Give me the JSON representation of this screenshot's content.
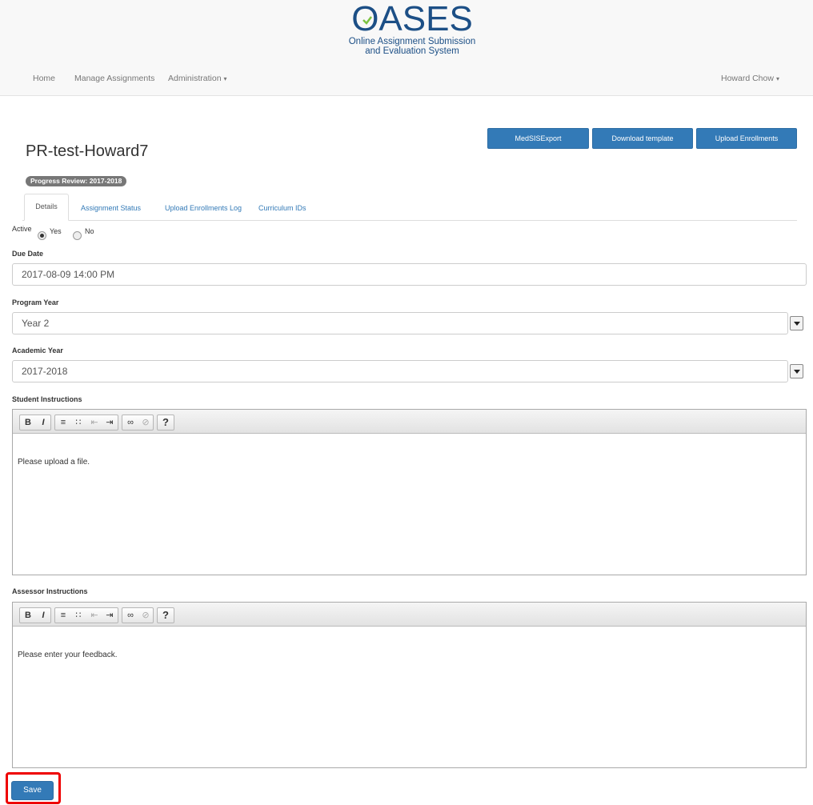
{
  "brand": {
    "logo_word": "OASES",
    "subtitle_line1": "Online Assignment Submission",
    "subtitle_line2": "and Evaluation System"
  },
  "nav": {
    "home": "Home",
    "manage": "Manage Assignments",
    "admin": "Administration",
    "user": "Howard Chow"
  },
  "page": {
    "title": "PR-test-Howard7",
    "badge": "Progress Review: 2017-2018"
  },
  "actions": {
    "medsis": "MedSISExport",
    "download": "Download template",
    "upload": "Upload Enrollments"
  },
  "tabs": {
    "details": "Details",
    "status": "Assignment Status",
    "log": "Upload Enrollments Log",
    "curriculum": "Curriculum IDs"
  },
  "form": {
    "active_label": "Active",
    "yes": "Yes",
    "no": "No",
    "due_label": "Due Date",
    "due_value": "2017-08-09 14:00 PM",
    "program_label": "Program Year",
    "program_value": "Year 2",
    "academic_label": "Academic Year",
    "academic_value": "2017-2018",
    "student_label": "Student Instructions",
    "student_text": "Please upload a file.",
    "assessor_label": "Assessor Instructions",
    "assessor_text": "Please enter your feedback.",
    "save": "Save"
  },
  "toolbar": {
    "bold": "B",
    "italic": "I",
    "help": "?"
  },
  "colors": {
    "primary": "#337ab7",
    "logo": "#1c4f86",
    "highlight": "#e00000"
  }
}
